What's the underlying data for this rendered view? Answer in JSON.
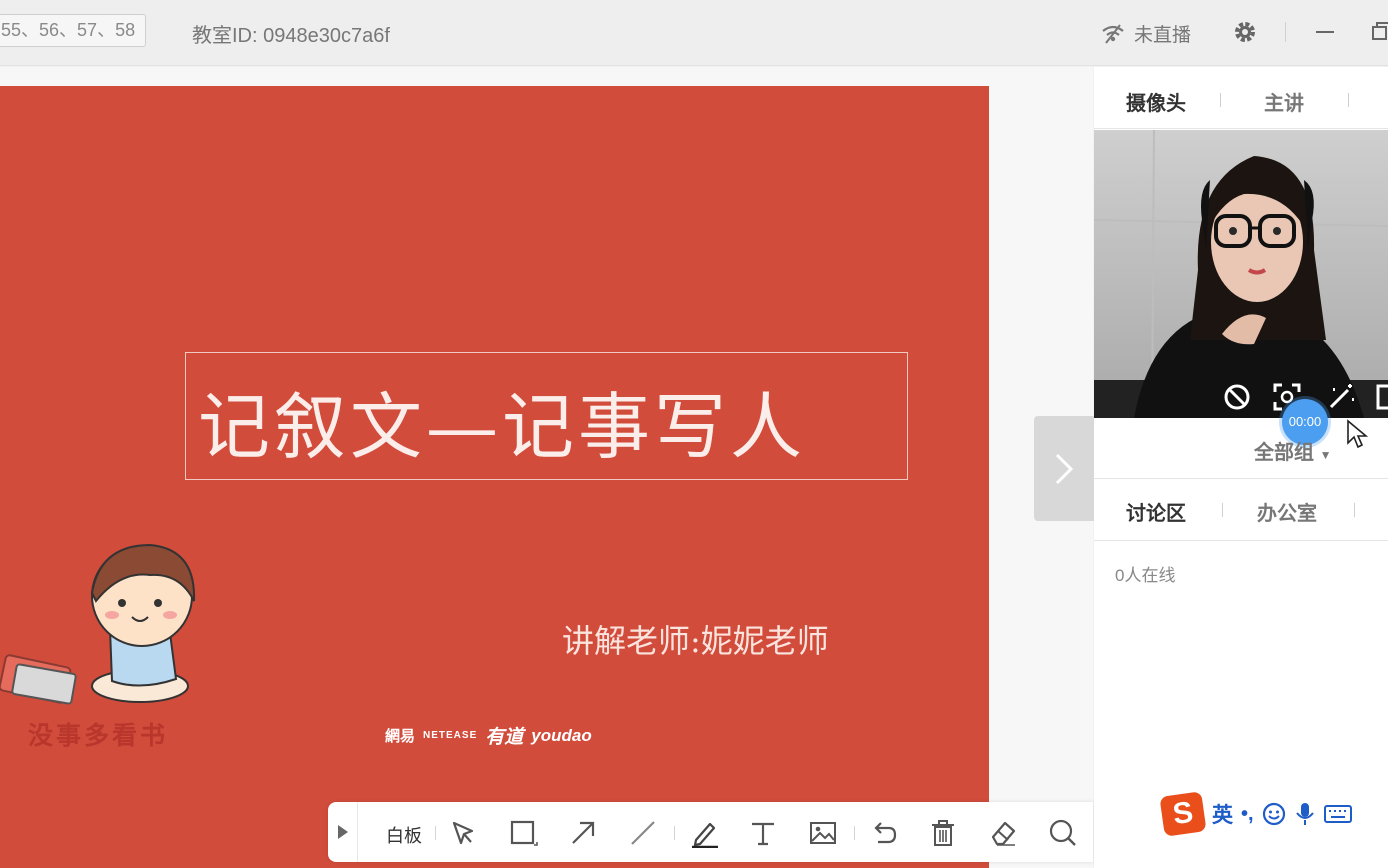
{
  "topbar": {
    "lesson_range": "55、56、57、58",
    "classroom_label": "教室ID:",
    "classroom_id": "0948e30c7a6f",
    "live_status": "未直播"
  },
  "slide": {
    "title": "记叙文—记事写人",
    "teacher": "讲解老师:妮妮老师",
    "sticker_caption": "没事多看书",
    "logo_netease_cn": "網易",
    "logo_netease_en": "NETEASE",
    "logo_youdao_cn": "有道",
    "logo_youdao_en": "youdao",
    "background_color": "#d24c3c"
  },
  "toolbar": {
    "whiteboard_label": "白板",
    "tools": [
      "select-icon",
      "rectangle-icon",
      "arrow-icon",
      "line-icon",
      "pen-icon",
      "text-icon",
      "image-icon",
      "undo-icon",
      "trash-icon",
      "eraser-icon",
      "zoom-icon"
    ]
  },
  "right_panel": {
    "video_tabs": [
      "摄像头",
      "主讲"
    ],
    "timer": "00:00",
    "group_select": "全部组",
    "chat_tabs": [
      "讨论区",
      "办公室"
    ],
    "online_count": "0人在线",
    "ime_logo": "S",
    "ime_lang": "英"
  },
  "colors": {
    "accent_blue": "#4c9ef0",
    "ime_orange": "#e94e1b"
  }
}
